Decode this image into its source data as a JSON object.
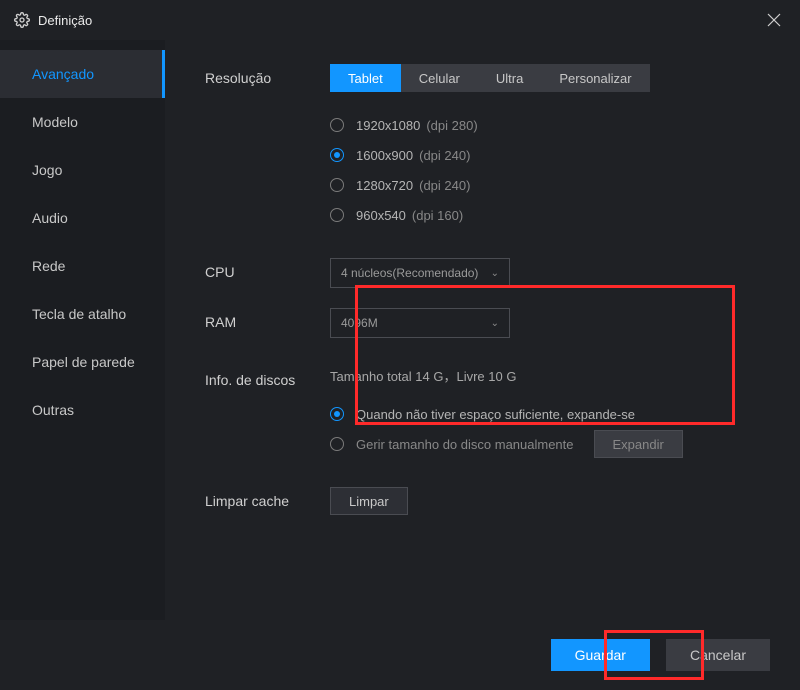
{
  "title": "Definição",
  "sidebar": {
    "items": [
      {
        "label": "Avançado"
      },
      {
        "label": "Modelo"
      },
      {
        "label": "Jogo"
      },
      {
        "label": "Audio"
      },
      {
        "label": "Rede"
      },
      {
        "label": "Tecla de atalho"
      },
      {
        "label": "Papel de parede"
      },
      {
        "label": "Outras"
      }
    ]
  },
  "resolution": {
    "label": "Resolução",
    "tabs": [
      "Tablet",
      "Celular",
      "Ultra",
      "Personalizar"
    ],
    "options": [
      {
        "res": "1920x1080",
        "dpi": "(dpi 280)"
      },
      {
        "res": "1600x900",
        "dpi": "(dpi 240)"
      },
      {
        "res": "1280x720",
        "dpi": "(dpi 240)"
      },
      {
        "res": "960x540",
        "dpi": "(dpi 160)"
      }
    ]
  },
  "cpu": {
    "label": "CPU",
    "value": "4 núcleos(Recomendado)"
  },
  "ram": {
    "label": "RAM",
    "value": "4096M"
  },
  "disk": {
    "label": "Info. de discos",
    "summary": "Tamanho total 14 G，Livre 10 G",
    "opt_auto": "Quando não tiver espaço suficiente, expande-se",
    "opt_manual": "Gerir tamanho do disco manualmente",
    "expand_btn": "Expandir"
  },
  "cache": {
    "label": "Limpar cache",
    "btn": "Limpar"
  },
  "footer": {
    "save": "Guardar",
    "cancel": "Cancelar"
  }
}
